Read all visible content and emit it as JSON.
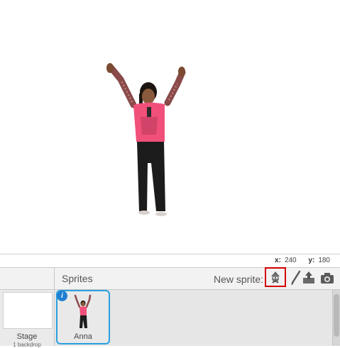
{
  "stage": {
    "sprite_name": "Anna",
    "coords": {
      "x_label": "x:",
      "x_value": "240",
      "y_label": "y:",
      "y_value": "180"
    }
  },
  "stage_panel": {
    "label": "Stage",
    "sublabel": "1 backdrop"
  },
  "sprites_panel": {
    "title": "Sprites",
    "new_sprite_label": "New sprite:",
    "tools": [
      "library-icon",
      "paintbrush-icon",
      "upload-icon",
      "camera-icon"
    ],
    "items": [
      {
        "name": "Anna",
        "selected": true
      }
    ]
  },
  "colors": {
    "selection": "#2aa0e0",
    "highlight": "#d40000",
    "shirt": "#f0507a"
  }
}
